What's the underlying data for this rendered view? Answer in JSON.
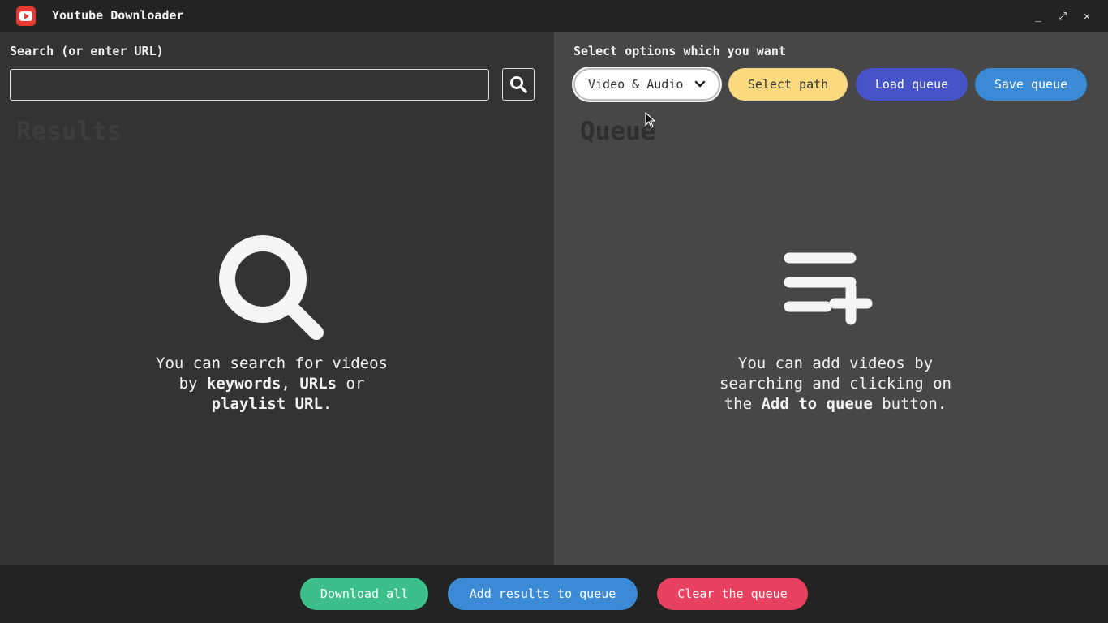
{
  "window": {
    "title": "Youtube Downloader",
    "controls": {
      "minimize": "_",
      "maximize": "⤢",
      "close": "✕"
    }
  },
  "left": {
    "search_label": "Search (or enter URL)",
    "search_value": "",
    "search_placeholder": "",
    "results_heading": "Results",
    "empty_state": {
      "line1": "You can search for videos",
      "line2_pre": "by ",
      "line2_kw1": "keywords",
      "line2_mid": ", ",
      "line2_kw2": "URLs",
      "line2_post": " or",
      "line3_kw": "playlist URL",
      "line3_post": "."
    }
  },
  "right": {
    "options_label": "Select options which you want",
    "format_select": {
      "value": "Video & Audio"
    },
    "select_path_label": "Select path",
    "load_queue_label": "Load queue",
    "save_queue_label": "Save queue",
    "queue_heading": "Queue",
    "empty_state": {
      "line1": "You can add videos by",
      "line2": "searching and clicking on",
      "line3_pre": "the ",
      "line3_kw": "Add to queue",
      "line3_post": " button."
    }
  },
  "bottom": {
    "download_all_label": "Download all",
    "add_results_label": "Add results to queue",
    "clear_queue_label": "Clear the queue"
  },
  "colors": {
    "green": "#3dbf8a",
    "blue": "#3a8ad6",
    "red": "#e8405f",
    "yellow": "#fbd97f",
    "indigo": "#4654c8"
  }
}
